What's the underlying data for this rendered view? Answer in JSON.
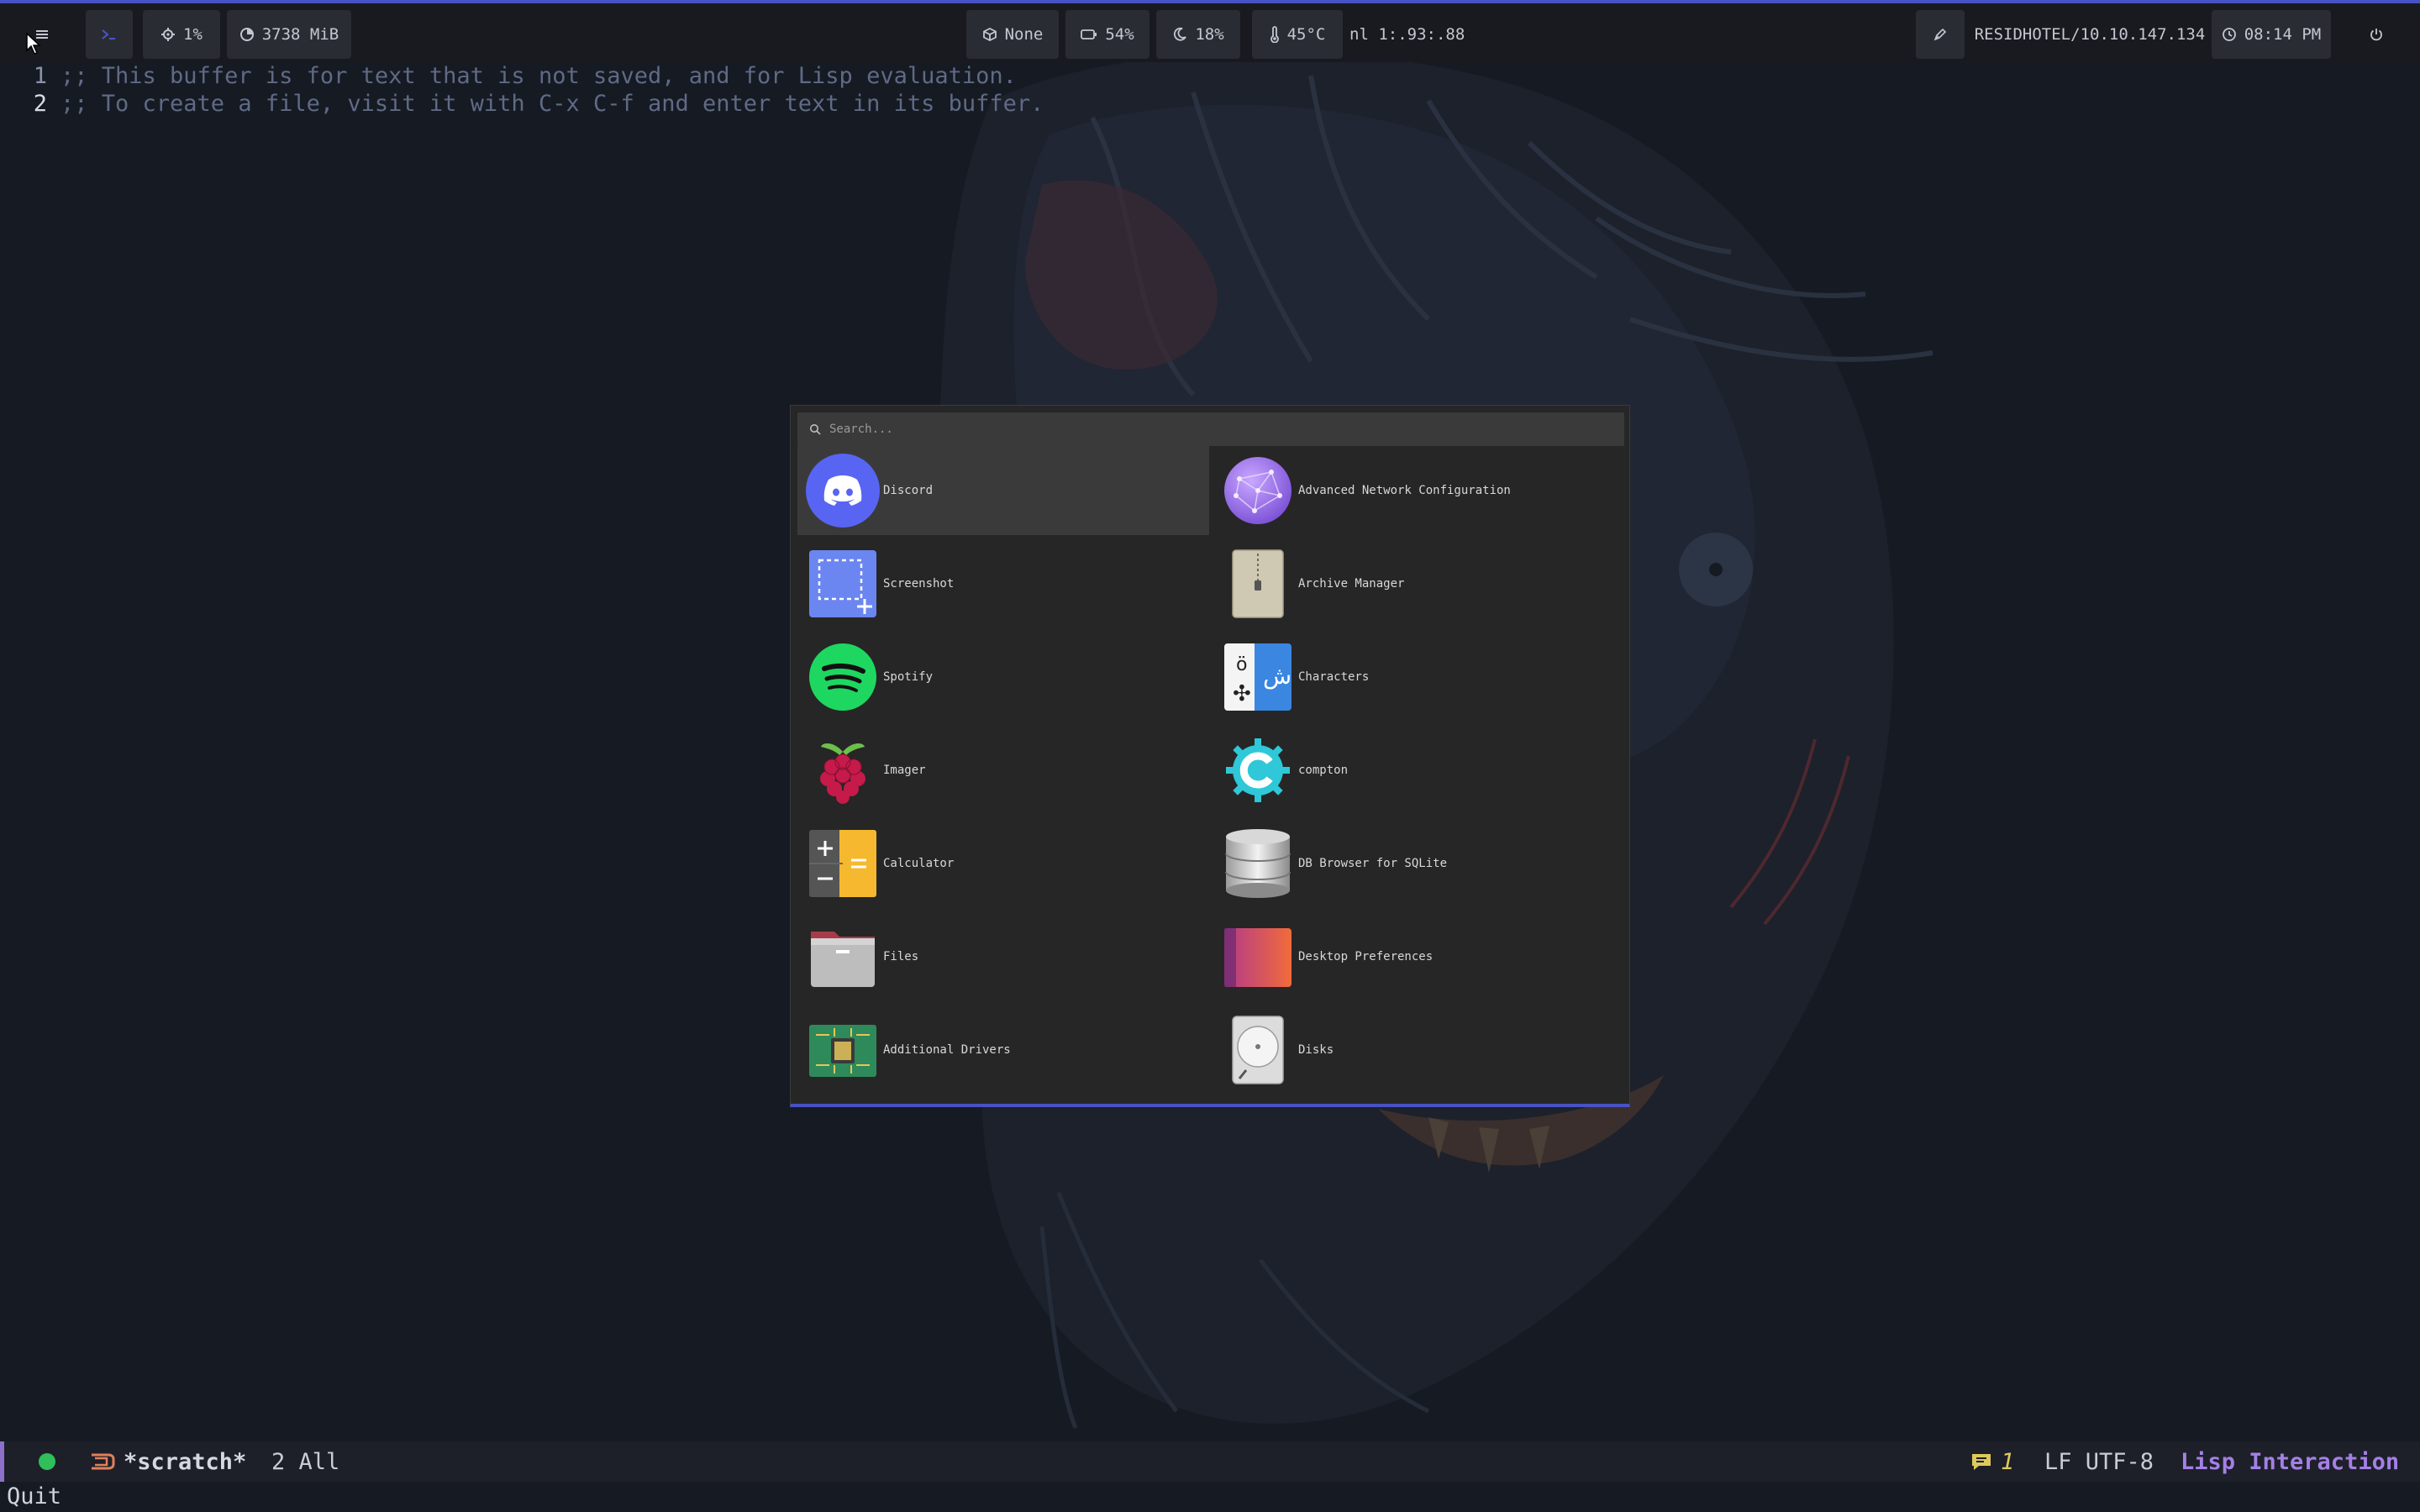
{
  "topbar": {
    "cpu": "1%",
    "memory": "3738 MiB",
    "updates": "None",
    "battery": "54%",
    "brightness": "18%",
    "temperature": "45°C",
    "network": "nl 1:.93:.88",
    "host": "RESIDHOTEL/10.10.147.134",
    "clock": "08:14 PM",
    "icons": [
      "menu-icon",
      "terminal-icon",
      "cpu-icon",
      "memory-icon",
      "package-icon",
      "battery-icon",
      "moon-icon",
      "thermometer-icon",
      "pen-icon",
      "clock-icon",
      "power-icon"
    ]
  },
  "editor": {
    "lines": [
      {
        "num": "1",
        "text": ";; This buffer is for text that is not saved, and for Lisp evaluation."
      },
      {
        "num": "2",
        "text": ";; To create a file, visit it with C-x C-f and enter text in its buffer."
      }
    ]
  },
  "launcher": {
    "search_placeholder": "Search...",
    "apps": [
      {
        "label": "Discord",
        "icon": "discord-icon"
      },
      {
        "label": "Advanced Network Configuration",
        "icon": "network-config-icon"
      },
      {
        "label": "Screenshot",
        "icon": "screenshot-icon"
      },
      {
        "label": "Archive Manager",
        "icon": "archive-icon"
      },
      {
        "label": "Spotify",
        "icon": "spotify-icon"
      },
      {
        "label": "Characters",
        "icon": "characters-icon"
      },
      {
        "label": "Imager",
        "icon": "raspberry-icon"
      },
      {
        "label": "compton",
        "icon": "compton-icon"
      },
      {
        "label": "Calculator",
        "icon": "calculator-icon"
      },
      {
        "label": "DB Browser for SQLite",
        "icon": "database-icon"
      },
      {
        "label": "Files",
        "icon": "folder-icon"
      },
      {
        "label": "Desktop Preferences",
        "icon": "desktop-preferences-icon"
      },
      {
        "label": "Additional Drivers",
        "icon": "chip-icon"
      },
      {
        "label": "Disks",
        "icon": "disk-icon"
      }
    ],
    "selected": "Discord"
  },
  "modeline": {
    "buffer_name": "*scratch*",
    "position": "2 All",
    "messages": "1",
    "encoding": "LF UTF-8",
    "major_mode": "Lisp Interaction"
  },
  "echo": {
    "text": "Quit"
  },
  "colors": {
    "accent": "#4752c4",
    "mode": "#a57fe6",
    "status_ok": "#2fbf5b",
    "warning": "#e0c95a"
  }
}
